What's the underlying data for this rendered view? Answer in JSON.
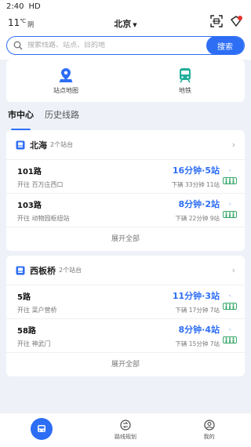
{
  "status_bar": {
    "time": "2:40",
    "hd": "HD"
  },
  "header": {
    "temperature": "11",
    "temp_unit": "℃",
    "weather": "阴",
    "city": "北京"
  },
  "search": {
    "placeholder": "搜索线路、站点、目的地",
    "button": "搜索"
  },
  "quick_links": [
    {
      "label": "站点地图",
      "icon": "map-pin-icon"
    },
    {
      "label": "地铁",
      "icon": "subway-icon"
    }
  ],
  "tabs": [
    {
      "label": "市中心",
      "active": true
    },
    {
      "label": "历史线路",
      "active": false
    }
  ],
  "stations": [
    {
      "name": "北海",
      "count": "2个站台",
      "routes": [
        {
          "name": "101路",
          "toward": "开往 百万庄西口",
          "eta": "16分钟·5站",
          "next": "下辆 33分钟 11站"
        },
        {
          "name": "103路",
          "toward": "开往 动物园枢纽站",
          "eta": "8分钟·2站",
          "next": "下辆 22分钟 9站"
        }
      ],
      "expand": "展开全部"
    },
    {
      "name": "西板桥",
      "count": "2个站台",
      "routes": [
        {
          "name": "5路",
          "toward": "开往 菜户营桥",
          "eta": "11分钟·3站",
          "next": "下辆 17分钟 7站"
        },
        {
          "name": "58路",
          "toward": "开往 神武门",
          "eta": "8分钟·4站",
          "next": "下辆 15分钟 7站"
        }
      ],
      "expand": "展开全部"
    }
  ],
  "bottom_nav": [
    {
      "label": "",
      "icon": "bus-home-icon"
    },
    {
      "label": "路线规划",
      "icon": "route-plan-icon"
    },
    {
      "label": "我的",
      "icon": "profile-icon"
    }
  ],
  "colors": {
    "accent": "#2d6ef5",
    "crowd_green": "#3aa86b",
    "subway_green": "#1fae9a"
  }
}
